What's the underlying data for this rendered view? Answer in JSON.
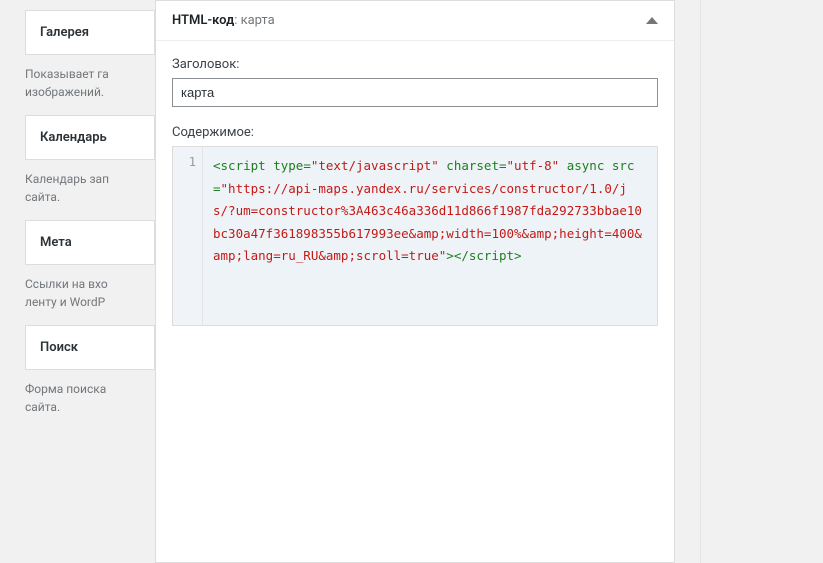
{
  "sidebar": {
    "items": [
      {
        "title": "Галерея",
        "desc": "Показывает га изображений."
      },
      {
        "title": "Календарь",
        "desc": "Календарь зап сайта."
      },
      {
        "title": "Мета",
        "desc": "Ссылки на вхо ленту и WordP"
      },
      {
        "title": "Поиск",
        "desc": "Форма поиска сайта."
      }
    ]
  },
  "panel": {
    "title_prefix": "HTML-код",
    "title_suffix": ": карта",
    "field_label_title": "Заголовок:",
    "title_value": "карта",
    "field_label_content": "Содержимое:",
    "line_number": "1",
    "code": {
      "open_tag": "<script",
      "attr_type": " type=",
      "val_type": "\"text/javascript\"",
      "attr_charset": " charset=",
      "val_charset": "\"utf-8\"",
      "attr_async": " async",
      "attr_src": " src=",
      "val_src": "\"https://api-maps.yandex.ru/services/constructor/1.0/js/?um=constructor%3A463c46a336d11d866f1987fda292733bbae10bc30a47f361898355b617993ee&amp;width=100%&amp;height=400&amp;lang=ru_RU&amp;scroll=true\"",
      "close_tag": "></script>"
    }
  }
}
